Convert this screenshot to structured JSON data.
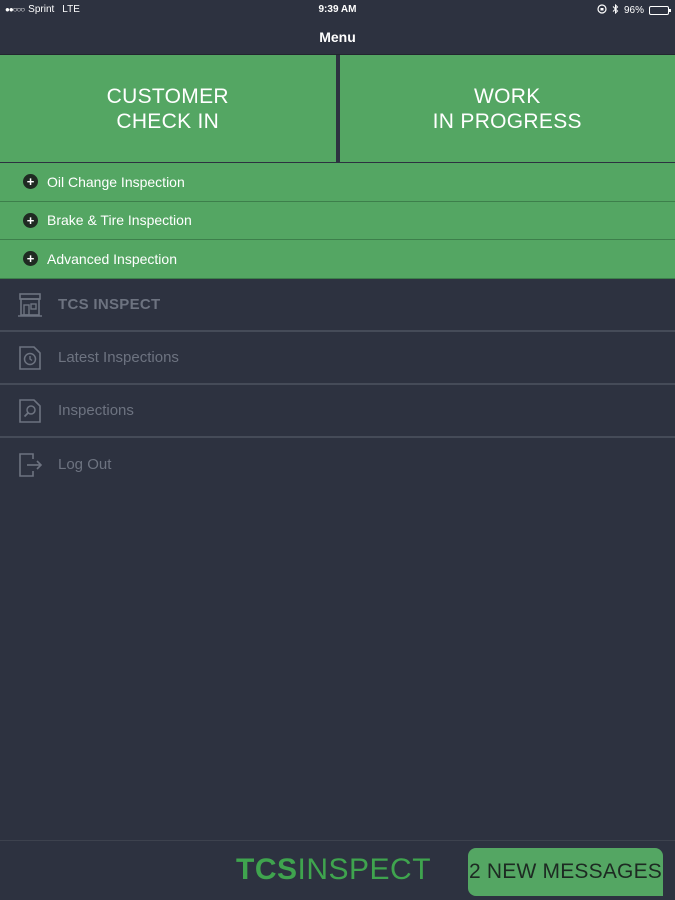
{
  "status_bar": {
    "signal": "●●○○○",
    "carrier": "Sprint",
    "network": "LTE",
    "time": "9:39 AM",
    "battery": "96%",
    "battery_level": 0.96
  },
  "nav": {
    "title": "Menu"
  },
  "big_buttons": [
    {
      "label": "CUSTOMER\nCHECK IN"
    },
    {
      "label": "WORK\nIN PROGRESS"
    }
  ],
  "inspections": [
    {
      "label": "Oil Change Inspection"
    },
    {
      "label": "Brake & Tire Inspection"
    },
    {
      "label": "Advanced Inspection"
    }
  ],
  "menu": [
    {
      "label": "TCS INSPECT",
      "icon": "storefront-icon"
    },
    {
      "label": "Latest Inspections",
      "icon": "clock-icon"
    },
    {
      "label": "Inspections",
      "icon": "search-document-icon"
    },
    {
      "label": "Log Out",
      "icon": "logout-icon"
    }
  ],
  "footer": {
    "logo_bold": "TCS",
    "logo_light": "INSPECT",
    "messages_button": "2 NEW MESSAGES"
  },
  "colors": {
    "background": "#2d3240",
    "accent_green": "#54a663",
    "logo_green": "#3fa44e",
    "muted_text": "#6d7380"
  }
}
